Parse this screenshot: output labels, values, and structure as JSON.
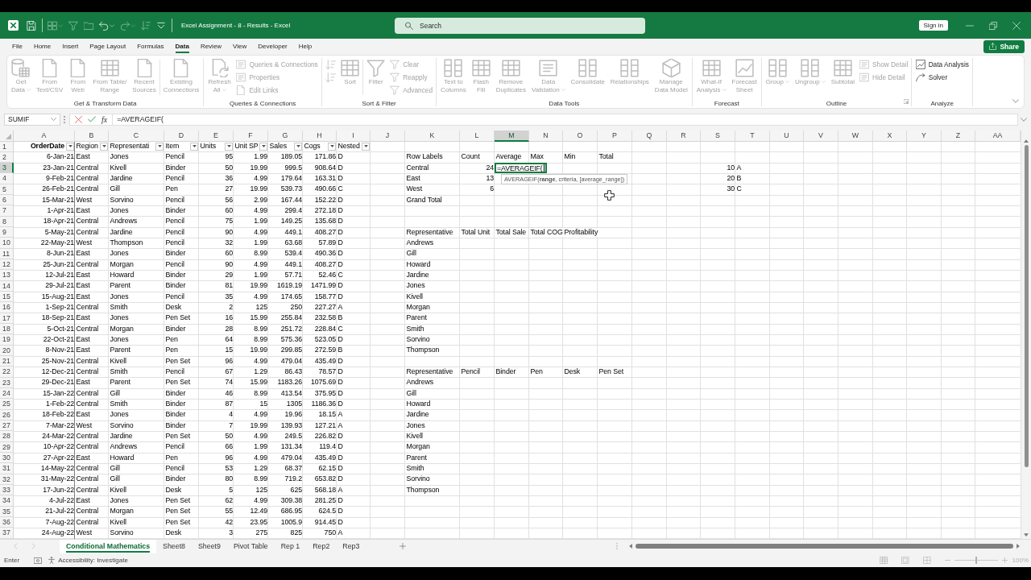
{
  "title_bar": {
    "quick_access": [
      {
        "disabled": false,
        "menu": false
      },
      {
        "disabled": true,
        "menu": true
      },
      {
        "disabled": true,
        "menu": false
      },
      {
        "disabled": true,
        "menu": false
      },
      {
        "disabled": false,
        "menu": true
      },
      {
        "disabled": true,
        "menu": true
      },
      {
        "disabled": true,
        "menu": false
      },
      {
        "disabled": false,
        "menu": false
      }
    ],
    "title": "Excel Assignment - 8 - Results - Excel",
    "search": {
      "placeholder": "Search"
    },
    "sign_in": "Sign in"
  },
  "menu_tabs": [
    {
      "label": "File",
      "selected": false
    },
    {
      "label": "Home",
      "selected": false
    },
    {
      "label": "Insert",
      "selected": false
    },
    {
      "label": "Page Layout",
      "selected": false
    },
    {
      "label": "Formulas",
      "selected": false
    },
    {
      "label": "Data",
      "selected": true
    },
    {
      "label": "Review",
      "selected": false
    },
    {
      "label": "View",
      "selected": false
    },
    {
      "label": "Developer",
      "selected": false
    },
    {
      "label": "Help",
      "selected": false
    }
  ],
  "share_button": "Share",
  "ribbon_groups": [
    {
      "label": "Get & Transform Data",
      "dialog_launcher": false,
      "commands": [
        {
          "kind": "large",
          "lines": [
            "Get",
            "Data"
          ],
          "menu": true,
          "disabled": true
        },
        {
          "kind": "large",
          "lines": [
            "From",
            "Text/CSV"
          ],
          "menu": false,
          "disabled": true
        },
        {
          "kind": "large",
          "lines": [
            "From",
            "Web"
          ],
          "menu": false,
          "disabled": true
        },
        {
          "kind": "large",
          "lines": [
            "From Table/",
            "Range"
          ],
          "menu": false,
          "disabled": true
        },
        {
          "kind": "large",
          "lines": [
            "Recent",
            "Sources"
          ],
          "menu": false,
          "disabled": true
        },
        {
          "kind": "separator"
        },
        {
          "kind": "large",
          "lines": [
            "Existing",
            "Connections"
          ],
          "menu": false,
          "disabled": true
        }
      ]
    },
    {
      "label": "Queries & Connections",
      "dialog_launcher": false,
      "commands": [
        {
          "kind": "large",
          "lines": [
            "Refresh",
            "All"
          ],
          "menu": true,
          "disabled": true
        },
        {
          "kind": "small",
          "lines": [
            "Queries & Connections"
          ],
          "menu": false,
          "disabled": true
        },
        {
          "kind": "small",
          "lines": [
            "Properties"
          ],
          "menu": false,
          "disabled": true
        },
        {
          "kind": "small",
          "lines": [
            "Edit Links"
          ],
          "menu": false,
          "disabled": true
        }
      ]
    },
    {
      "label": "Sort & Filter",
      "dialog_launcher": false,
      "commands": [
        {
          "kind": "icon",
          "menu": false,
          "disabled": true
        },
        {
          "kind": "icon",
          "menu": false,
          "disabled": true
        },
        {
          "kind": "large",
          "lines": [
            "Sort"
          ],
          "menu": false,
          "disabled": true
        },
        {
          "kind": "separator"
        },
        {
          "kind": "large",
          "lines": [
            "Filter"
          ],
          "menu": false,
          "disabled": true
        },
        {
          "kind": "small",
          "lines": [
            "Clear"
          ],
          "menu": false,
          "disabled": true
        },
        {
          "kind": "small",
          "lines": [
            "Reapply"
          ],
          "menu": false,
          "disabled": true
        },
        {
          "kind": "small",
          "lines": [
            "Advanced"
          ],
          "menu": false,
          "disabled": true
        }
      ]
    },
    {
      "label": "Data Tools",
      "dialog_launcher": false,
      "commands": [
        {
          "kind": "large",
          "lines": [
            "Text to",
            "Columns"
          ],
          "menu": false,
          "disabled": true
        },
        {
          "kind": "large",
          "lines": [
            "Flash",
            "Fill"
          ],
          "menu": false,
          "disabled": true
        },
        {
          "kind": "large",
          "lines": [
            "Remove",
            "Duplicates"
          ],
          "menu": false,
          "disabled": true
        },
        {
          "kind": "large",
          "lines": [
            "Data",
            "Validation"
          ],
          "menu": true,
          "disabled": true
        },
        {
          "kind": "large",
          "lines": [
            "Consolidate"
          ],
          "menu": false,
          "disabled": true
        },
        {
          "kind": "large",
          "lines": [
            "Relationships"
          ],
          "menu": false,
          "disabled": true
        },
        {
          "kind": "large",
          "lines": [
            "Manage",
            "Data Model"
          ],
          "menu": false,
          "disabled": true
        }
      ]
    },
    {
      "label": "Forecast",
      "dialog_launcher": false,
      "commands": [
        {
          "kind": "large",
          "lines": [
            "What-If",
            "Analysis"
          ],
          "menu": true,
          "disabled": true
        },
        {
          "kind": "large",
          "lines": [
            "Forecast",
            "Sheet"
          ],
          "menu": false,
          "disabled": true
        }
      ]
    },
    {
      "label": "Outline",
      "dialog_launcher": true,
      "commands": [
        {
          "kind": "large",
          "lines": [
            "Group"
          ],
          "menu": true,
          "disabled": true
        },
        {
          "kind": "large",
          "lines": [
            "Ungroup"
          ],
          "menu": true,
          "disabled": true
        },
        {
          "kind": "large",
          "lines": [
            "Subtotal"
          ],
          "menu": false,
          "disabled": true
        },
        {
          "kind": "small",
          "lines": [
            "Show Detail"
          ],
          "menu": false,
          "disabled": true
        },
        {
          "kind": "small",
          "lines": [
            "Hide Detail"
          ],
          "menu": false,
          "disabled": true
        }
      ]
    },
    {
      "label": "Analyze",
      "dialog_launcher": false,
      "commands": [
        {
          "kind": "small",
          "lines": [
            "Data Analysis"
          ],
          "menu": false,
          "disabled": false
        },
        {
          "kind": "small",
          "lines": [
            "Solver"
          ],
          "menu": false,
          "disabled": false
        }
      ]
    }
  ],
  "formula_bar": {
    "name_box": "SUMIF",
    "function_symbol": "fx",
    "formula": "=AVERAGEIF("
  },
  "column_headers": [
    {
      "letter": "A",
      "selected": false
    },
    {
      "letter": "B",
      "selected": false
    },
    {
      "letter": "C",
      "selected": false
    },
    {
      "letter": "D",
      "selected": false
    },
    {
      "letter": "E",
      "selected": false
    },
    {
      "letter": "F",
      "selected": false
    },
    {
      "letter": "G",
      "selected": false
    },
    {
      "letter": "H",
      "selected": false
    },
    {
      "letter": "I",
      "selected": false
    },
    {
      "letter": "J",
      "selected": false
    },
    {
      "letter": "K",
      "selected": false
    },
    {
      "letter": "L",
      "selected": false
    },
    {
      "letter": "M",
      "selected": true
    },
    {
      "letter": "N",
      "selected": false
    },
    {
      "letter": "O",
      "selected": false
    },
    {
      "letter": "P",
      "selected": false
    },
    {
      "letter": "Q",
      "selected": false
    },
    {
      "letter": "R",
      "selected": false
    },
    {
      "letter": "S",
      "selected": false
    },
    {
      "letter": "T",
      "selected": false
    },
    {
      "letter": "U",
      "selected": false
    },
    {
      "letter": "V",
      "selected": false
    },
    {
      "letter": "W",
      "selected": false
    },
    {
      "letter": "X",
      "selected": false
    },
    {
      "letter": "Y",
      "selected": false
    },
    {
      "letter": "Z",
      "selected": false
    },
    {
      "letter": "AA",
      "selected": false
    }
  ],
  "row_headers": [
    {
      "label": "1",
      "selected": false
    },
    {
      "label": "2",
      "selected": false
    },
    {
      "label": "3",
      "selected": true
    },
    {
      "label": "4",
      "selected": false
    },
    {
      "label": "5",
      "selected": false
    },
    {
      "label": "6",
      "selected": false
    },
    {
      "label": "7",
      "selected": false
    },
    {
      "label": "8",
      "selected": false
    },
    {
      "label": "9",
      "selected": false
    },
    {
      "label": "10",
      "selected": false
    },
    {
      "label": "11",
      "selected": false
    },
    {
      "label": "12",
      "selected": false
    },
    {
      "label": "13",
      "selected": false
    },
    {
      "label": "14",
      "selected": false
    },
    {
      "label": "15",
      "selected": false
    },
    {
      "label": "16",
      "selected": false
    },
    {
      "label": "17",
      "selected": false
    },
    {
      "label": "18",
      "selected": false
    },
    {
      "label": "19",
      "selected": false
    },
    {
      "label": "20",
      "selected": false
    },
    {
      "label": "21",
      "selected": false
    },
    {
      "label": "22",
      "selected": false
    },
    {
      "label": "23",
      "selected": false
    },
    {
      "label": "24",
      "selected": false
    },
    {
      "label": "25",
      "selected": false
    },
    {
      "label": "26",
      "selected": false
    },
    {
      "label": "27",
      "selected": false
    },
    {
      "label": "28",
      "selected": false
    },
    {
      "label": "29",
      "selected": false
    },
    {
      "label": "30",
      "selected": false
    },
    {
      "label": "31",
      "selected": false
    },
    {
      "label": "32",
      "selected": false
    },
    {
      "label": "33",
      "selected": false
    },
    {
      "label": "34",
      "selected": false
    },
    {
      "label": "35",
      "selected": false
    },
    {
      "label": "36",
      "selected": false
    },
    {
      "label": "37",
      "selected": false
    }
  ],
  "table": {
    "filters": true,
    "headers": [
      {
        "label": "OrderDate",
        "kind": "date",
        "bold": true
      },
      {
        "label": "Region",
        "kind": "text",
        "bold": false
      },
      {
        "label": "Representati",
        "kind": "text",
        "bold": false
      },
      {
        "label": "Item",
        "kind": "text",
        "bold": false
      },
      {
        "label": "Units",
        "kind": "number",
        "bold": false
      },
      {
        "label": "Unit SP",
        "kind": "number",
        "bold": false
      },
      {
        "label": "Sales",
        "kind": "number",
        "bold": false
      },
      {
        "label": "Cogs",
        "kind": "number",
        "bold": false
      },
      {
        "label": "Nested",
        "kind": "text",
        "bold": false
      }
    ],
    "rows": [
      [
        "6-Jan-21",
        "East",
        "Jones",
        "Pencil",
        "95",
        "1.99",
        "189.05",
        "171.86",
        "D"
      ],
      [
        "23-Jan-21",
        "Central",
        "Kivell",
        "Binder",
        "50",
        "19.99",
        "999.5",
        "908.64",
        "D"
      ],
      [
        "9-Feb-21",
        "Central",
        "Jardine",
        "Pencil",
        "36",
        "4.99",
        "179.64",
        "163.31",
        "D"
      ],
      [
        "26-Feb-21",
        "Central",
        "Gill",
        "Pen",
        "27",
        "19.99",
        "539.73",
        "490.66",
        "C"
      ],
      [
        "15-Mar-21",
        "West",
        "Sorvino",
        "Pencil",
        "56",
        "2.99",
        "167.44",
        "152.22",
        "D"
      ],
      [
        "1-Apr-21",
        "East",
        "Jones",
        "Binder",
        "60",
        "4.99",
        "299.4",
        "272.18",
        "D"
      ],
      [
        "18-Apr-21",
        "Central",
        "Andrews",
        "Pencil",
        "75",
        "1.99",
        "149.25",
        "135.68",
        "D"
      ],
      [
        "5-May-21",
        "Central",
        "Jardine",
        "Pencil",
        "90",
        "4.99",
        "449.1",
        "408.27",
        "D"
      ],
      [
        "22-May-21",
        "West",
        "Thompson",
        "Pencil",
        "32",
        "1.99",
        "63.68",
        "57.89",
        "D"
      ],
      [
        "8-Jun-21",
        "East",
        "Jones",
        "Binder",
        "60",
        "8.99",
        "539.4",
        "490.36",
        "D"
      ],
      [
        "25-Jun-21",
        "Central",
        "Morgan",
        "Pencil",
        "90",
        "4.99",
        "449.1",
        "408.27",
        "D"
      ],
      [
        "12-Jul-21",
        "East",
        "Howard",
        "Binder",
        "29",
        "1.99",
        "57.71",
        "52.46",
        "C"
      ],
      [
        "29-Jul-21",
        "East",
        "Parent",
        "Binder",
        "81",
        "19.99",
        "1619.19",
        "1471.99",
        "D"
      ],
      [
        "15-Aug-21",
        "East",
        "Jones",
        "Pencil",
        "35",
        "4.99",
        "174.65",
        "158.77",
        "D"
      ],
      [
        "1-Sep-21",
        "Central",
        "Smith",
        "Desk",
        "2",
        "125",
        "250",
        "227.27",
        "A"
      ],
      [
        "18-Sep-21",
        "East",
        "Jones",
        "Pen Set",
        "16",
        "15.99",
        "255.84",
        "232.58",
        "B"
      ],
      [
        "5-Oct-21",
        "Central",
        "Morgan",
        "Binder",
        "28",
        "8.99",
        "251.72",
        "228.84",
        "C"
      ],
      [
        "22-Oct-21",
        "East",
        "Jones",
        "Pen",
        "64",
        "8.99",
        "575.36",
        "523.05",
        "D"
      ],
      [
        "8-Nov-21",
        "East",
        "Parent",
        "Pen",
        "15",
        "19.99",
        "299.85",
        "272.59",
        "B"
      ],
      [
        "25-Nov-21",
        "Central",
        "Kivell",
        "Pen Set",
        "96",
        "4.99",
        "479.04",
        "435.49",
        "D"
      ],
      [
        "12-Dec-21",
        "Central",
        "Smith",
        "Pencil",
        "67",
        "1.29",
        "86.43",
        "78.57",
        "D"
      ],
      [
        "29-Dec-21",
        "East",
        "Parent",
        "Pen Set",
        "74",
        "15.99",
        "1183.26",
        "1075.69",
        "D"
      ],
      [
        "15-Jan-22",
        "Central",
        "Gill",
        "Binder",
        "46",
        "8.99",
        "413.54",
        "375.95",
        "D"
      ],
      [
        "1-Feb-22",
        "Central",
        "Smith",
        "Binder",
        "87",
        "15",
        "1305",
        "1186.36",
        "D"
      ],
      [
        "18-Feb-22",
        "East",
        "Jones",
        "Binder",
        "4",
        "4.99",
        "19.96",
        "18.15",
        "A"
      ],
      [
        "7-Mar-22",
        "West",
        "Sorvino",
        "Binder",
        "7",
        "19.99",
        "139.93",
        "127.21",
        "A"
      ],
      [
        "24-Mar-22",
        "Central",
        "Jardine",
        "Pen Set",
        "50",
        "4.99",
        "249.5",
        "226.82",
        "D"
      ],
      [
        "10-Apr-22",
        "Central",
        "Andrews",
        "Pencil",
        "66",
        "1.99",
        "131.34",
        "119.4",
        "D"
      ],
      [
        "27-Apr-22",
        "East",
        "Howard",
        "Pen",
        "96",
        "4.99",
        "479.04",
        "435.49",
        "D"
      ],
      [
        "14-May-22",
        "Central",
        "Gill",
        "Pencil",
        "53",
        "1.29",
        "68.37",
        "62.15",
        "D"
      ],
      [
        "31-May-22",
        "Central",
        "Gill",
        "Binder",
        "80",
        "8.99",
        "719.2",
        "653.82",
        "D"
      ],
      [
        "17-Jun-22",
        "Central",
        "Kivell",
        "Desk",
        "5",
        "125",
        "625",
        "568.18",
        "A"
      ],
      [
        "4-Jul-22",
        "East",
        "Jones",
        "Pen Set",
        "62",
        "4.99",
        "309.38",
        "281.25",
        "D"
      ],
      [
        "21-Jul-22",
        "Central",
        "Morgan",
        "Pen Set",
        "55",
        "12.49",
        "686.95",
        "624.5",
        "D"
      ],
      [
        "7-Aug-22",
        "Central",
        "Kivell",
        "Pen Set",
        "42",
        "23.95",
        "1005.9",
        "914.45",
        "D"
      ],
      [
        "24-Aug-22",
        "West",
        "Sorvino",
        "Desk",
        "3",
        "275",
        "825",
        "750",
        "A"
      ]
    ]
  },
  "summary": {
    "headers": [
      "Row Labels",
      "Count",
      "Average",
      "Max",
      "Min",
      "Total"
    ],
    "rows": [
      {
        "label": "Central",
        "count": "24"
      },
      {
        "label": "East",
        "count": "13"
      },
      {
        "label": "West",
        "count": "6"
      },
      {
        "label": "Grand Total"
      }
    ]
  },
  "editing_cell": {
    "text": "=AVERAGEIF(",
    "hint": "AVERAGEIF(**range**, criteria, [average_range])"
  },
  "grade_lookup": [
    {
      "threshold": "10",
      "grade": "A"
    },
    {
      "threshold": "20",
      "grade": "B"
    },
    {
      "threshold": "30",
      "grade": "C"
    }
  ],
  "rep_totals": {
    "headers": [
      "Representative",
      "Total Unit",
      "Total Sale",
      "Total COG",
      "Profitability"
    ],
    "rows": [
      "Andrews",
      "Gill",
      "Howard",
      "Jardine",
      "Jones",
      "Kivell",
      "Morgan",
      "Parent",
      "Smith",
      "Sorvino",
      "Thompson"
    ]
  },
  "rep_items": {
    "headers": [
      "Representative",
      "Pencil",
      "Binder",
      "Pen",
      "Desk",
      "Pen Set"
    ],
    "rows": [
      "Andrews",
      "Gill",
      "Howard",
      "Jardine",
      "Jones",
      "Kivell",
      "Morgan",
      "Parent",
      "Smith",
      "Sorvino",
      "Thompson"
    ]
  },
  "sheet_tabs": [
    {
      "label": "Conditional Mathematics",
      "selected": true
    },
    {
      "label": "Sheet8",
      "selected": false
    },
    {
      "label": "Sheet9",
      "selected": false
    },
    {
      "label": "Pivot Table",
      "selected": false
    },
    {
      "label": "Rep 1",
      "selected": false
    },
    {
      "label": "Rep2",
      "selected": false
    },
    {
      "label": "Rep3",
      "selected": false
    }
  ],
  "status_bar": {
    "mode": "Enter",
    "accessibility": "Accessibility: Investigate",
    "zoom": {
      "level": 0.5,
      "reading": "100%"
    }
  }
}
